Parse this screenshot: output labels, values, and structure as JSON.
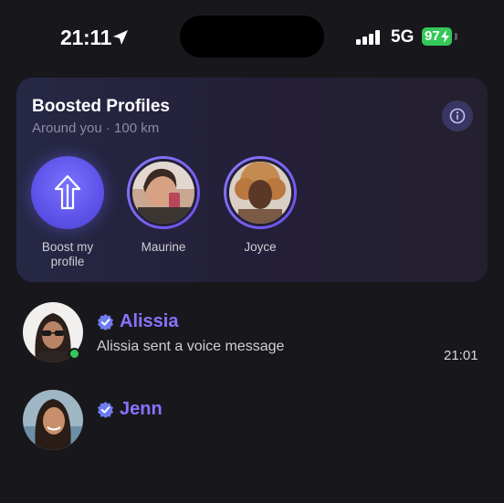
{
  "status_bar": {
    "time": "21:11",
    "network": "5G",
    "battery": "97",
    "icons": [
      "location-arrow-icon",
      "signal-icon",
      "charging-bolt-icon"
    ]
  },
  "boosted": {
    "title": "Boosted Profiles",
    "subtitle": "Around you · 100 km",
    "info_icon": "info-icon",
    "stories": [
      {
        "label": "Boost my profile",
        "icon": "boost-arrow-icon"
      },
      {
        "label": "Maurine"
      },
      {
        "label": "Joyce"
      }
    ]
  },
  "chats": [
    {
      "name": "Alissia",
      "preview": "Alissia sent a voice message",
      "time": "21:01",
      "verified": true,
      "online": true
    },
    {
      "name": "Jenn",
      "verified": true,
      "online": false
    }
  ],
  "colors": {
    "background": "#18181c",
    "accent": "#8a72ff",
    "verified": "#6f7cf0",
    "online": "#34c759",
    "battery": "#34c759"
  }
}
